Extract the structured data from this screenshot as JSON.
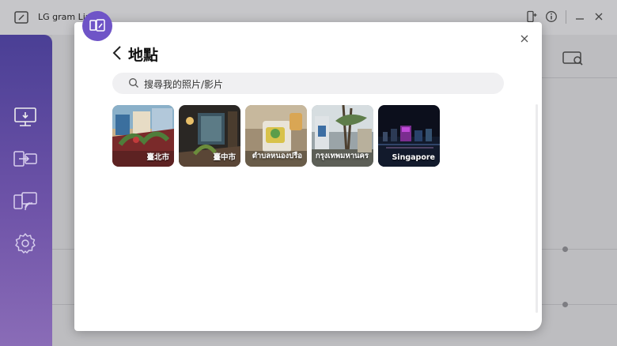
{
  "app": {
    "title": "LG gram Link"
  },
  "modal": {
    "title": "地點",
    "search": {
      "placeholder": "搜尋我的照片/影片",
      "value": ""
    },
    "locations": [
      {
        "name": "臺北市"
      },
      {
        "name": "臺中市"
      },
      {
        "name": "ตำบลหนองปรือ"
      },
      {
        "name": "กรุงเทพมหานคร"
      },
      {
        "name": "Singapore"
      }
    ]
  },
  "sidebar": {
    "items": [
      {
        "icon": "screen-share-icon"
      },
      {
        "icon": "file-transfer-icon"
      },
      {
        "icon": "cast-icon"
      },
      {
        "icon": "settings-gear-icon"
      }
    ]
  },
  "colors": {
    "accent": "#6f54c7",
    "sidebar_top": "#4a3f95",
    "sidebar_bottom": "#8a6cb7"
  }
}
